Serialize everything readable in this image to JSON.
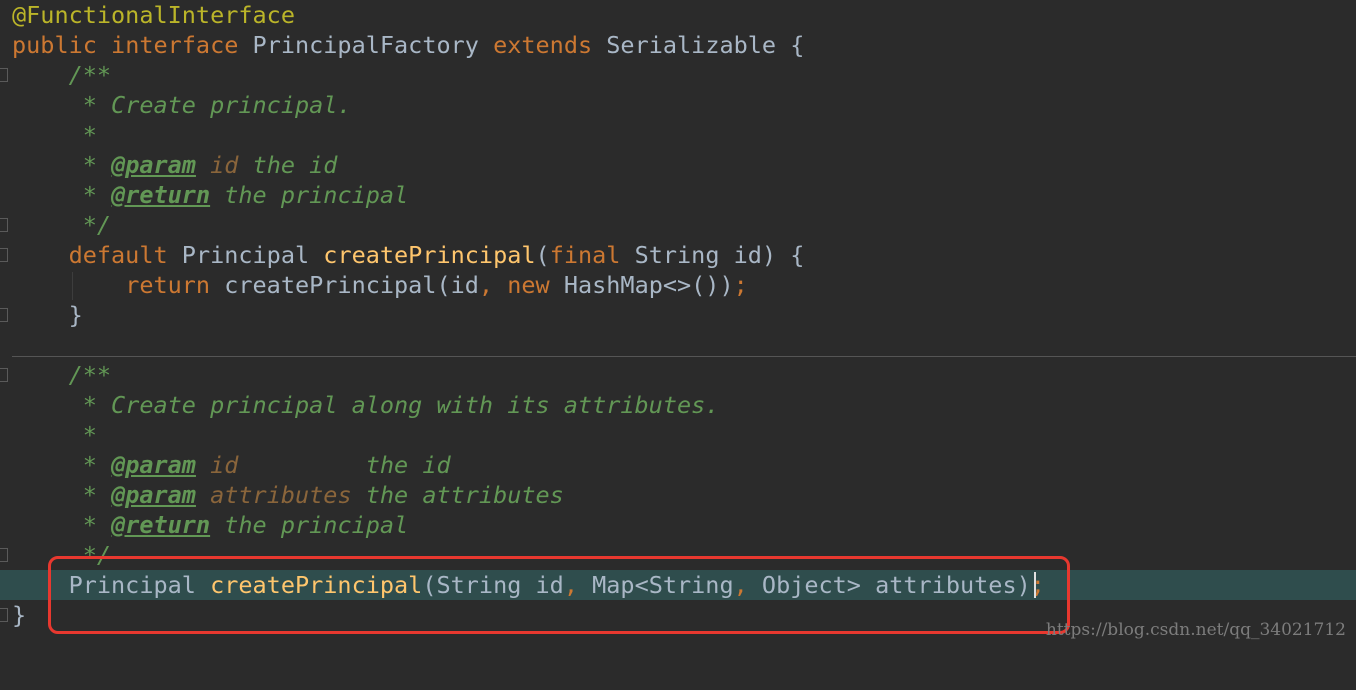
{
  "code": {
    "annotation": "@FunctionalInterface",
    "l2": {
      "kw1": "public",
      "kw2": "interface",
      "name": "PrincipalFactory",
      "kw3": "extends",
      "parent": "Serializable",
      "brace": "{"
    },
    "doc1": {
      "open": "/**",
      "summary": "* Create principal.",
      "blank": "*",
      "star": "*",
      "param_tag": "@param",
      "param_name": "id",
      "param_desc": "the id",
      "return_tag": "@return",
      "return_desc": "the principal",
      "close": "*/"
    },
    "m1": {
      "kw": "default",
      "type": "Principal",
      "name": "createPrincipal",
      "open": "(",
      "final": "final",
      "ptype": "String",
      "pname": "id",
      "close": ") {",
      "ret": "return",
      "call": "createPrincipal(id",
      "comma": ",",
      "new": "new",
      "ctor": "HashMap<>())",
      "semi": ";",
      "end": "}"
    },
    "doc2": {
      "open": "/**",
      "summary": "* Create principal along with its attributes.",
      "blank": "*",
      "star": "*",
      "param_tag": "@param",
      "p1_name": "id",
      "p1_desc": "the id",
      "p2_name": "attributes",
      "p2_desc": "the attributes",
      "return_tag": "@return",
      "return_desc": "the principal",
      "close": "*/"
    },
    "m2": {
      "type": "Principal",
      "name": "createPrincipal",
      "p1": "(String id",
      "comma": ",",
      "p2a": "Map<String",
      "p2b": "Object> attributes)",
      "semi": ";"
    },
    "end": "}"
  },
  "watermark": "https://blog.csdn.net/qq_34021712"
}
